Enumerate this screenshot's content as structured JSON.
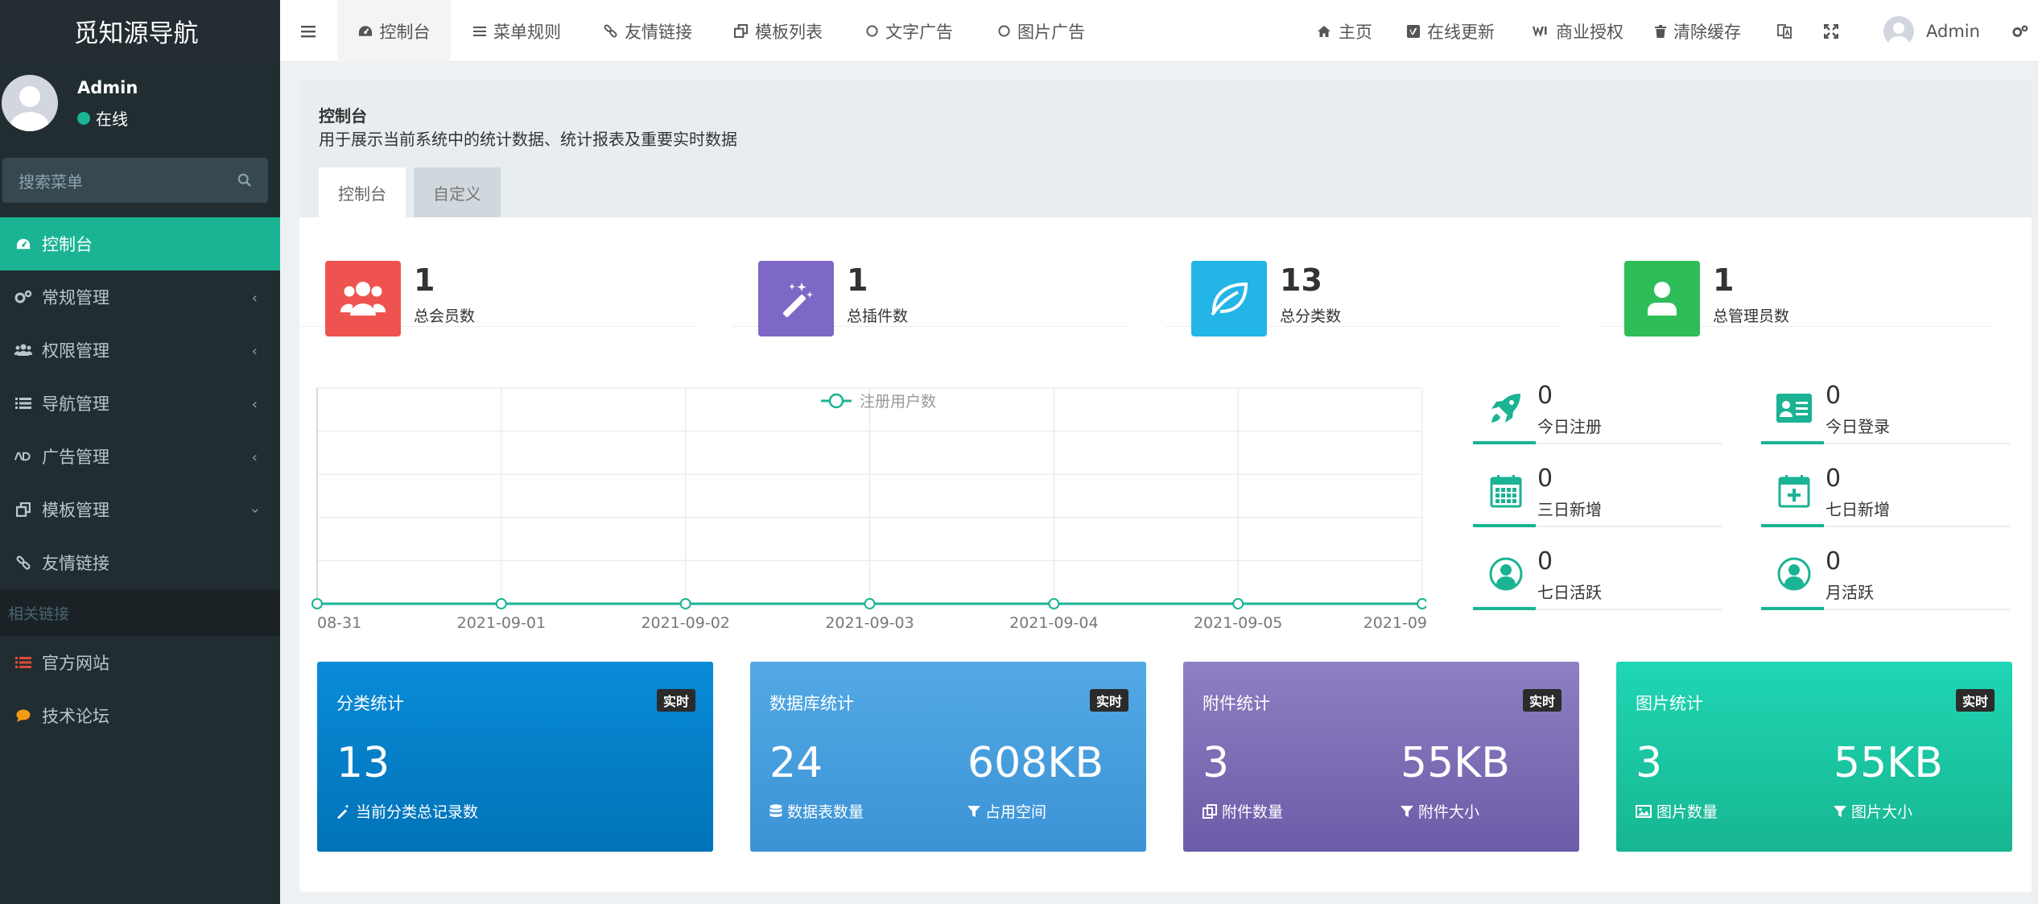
{
  "sidebar": {
    "logo": "觅知源导航",
    "user": {
      "name": "Admin",
      "status": "在线"
    },
    "search_placeholder": "搜索菜单",
    "menu": [
      {
        "label": "控制台",
        "icon": "dashboard-icon",
        "active": true
      },
      {
        "label": "常规管理",
        "icon": "cogs-icon"
      },
      {
        "label": "权限管理",
        "icon": "users-icon"
      },
      {
        "label": "导航管理",
        "icon": "list-icon"
      },
      {
        "label": "广告管理",
        "icon": "ad-icon"
      },
      {
        "label": "模板管理",
        "icon": "clone-icon"
      },
      {
        "label": "友情链接",
        "icon": "link-icon"
      }
    ],
    "related_heading": "相关链接",
    "related": [
      {
        "label": "官方网站",
        "icon": "list-red-icon",
        "color": "#dd4b39"
      },
      {
        "label": "技术论坛",
        "icon": "comment-yellow-icon",
        "color": "#f39c12"
      }
    ]
  },
  "topbar": {
    "left_tabs": [
      "控制台",
      "菜单规则",
      "友情链接",
      "模板列表",
      "文字广告",
      "图片广告"
    ],
    "right_items": [
      "主页",
      "在线更新",
      "商业授权",
      "清除缓存"
    ],
    "user_name": "Admin"
  },
  "page": {
    "title": "控制台",
    "description": "用于展示当前系统中的统计数据、统计报表及重要实时数据",
    "tabs": [
      "控制台",
      "自定义"
    ]
  },
  "stats": [
    {
      "value": "1",
      "label": "总会员数",
      "color": "#ef5350",
      "icon": "users-icon"
    },
    {
      "value": "1",
      "label": "总插件数",
      "color": "#7e68c5",
      "icon": "magic-wand-icon"
    },
    {
      "value": "13",
      "label": "总分类数",
      "color": "#22b5e6",
      "icon": "leaf-icon"
    },
    {
      "value": "1",
      "label": "总管理员数",
      "color": "#2ebd59",
      "icon": "user-icon"
    }
  ],
  "chart_data": {
    "type": "line",
    "categories": [
      "08-31",
      "2021-09-01",
      "2021-09-02",
      "2021-09-03",
      "2021-09-04",
      "2021-09-05",
      "2021-09"
    ],
    "series": [
      {
        "name": "注册用户数",
        "values": [
          0,
          0,
          0,
          0,
          0,
          0,
          0
        ]
      }
    ],
    "legend": "top-center",
    "grid": true,
    "color": "#1ab394"
  },
  "mini_stats": [
    {
      "value": "0",
      "label": "今日注册",
      "icon": "rocket-icon"
    },
    {
      "value": "0",
      "label": "今日登录",
      "icon": "id-card-icon"
    },
    {
      "value": "0",
      "label": "三日新增",
      "icon": "calendar-icon"
    },
    {
      "value": "0",
      "label": "七日新增",
      "icon": "calendar-plus-icon"
    },
    {
      "value": "0",
      "label": "七日活跃",
      "icon": "user-circle-icon"
    },
    {
      "value": "0",
      "label": "月活跃",
      "icon": "user-circle-icon"
    }
  ],
  "cards": [
    {
      "title": "分类统计",
      "badge": "实时",
      "v1": "13",
      "l1": "当前分类总记录数",
      "v2": "",
      "l2": "",
      "c1": "#0a8bd8",
      "c2": "#0073b7"
    },
    {
      "title": "数据库统计",
      "badge": "实时",
      "v1": "24",
      "l1": "数据表数量",
      "v2": "608KB",
      "l2": "占用空间",
      "c1": "#53a9e5",
      "c2": "#3b93d6"
    },
    {
      "title": "附件统计",
      "badge": "实时",
      "v1": "3",
      "l1": "附件数量",
      "v2": "55KB",
      "l2": "附件大小",
      "c1": "#8e7fc2",
      "c2": "#6c5ca8"
    },
    {
      "title": "图片统计",
      "badge": "实时",
      "v1": "3",
      "l1": "图片数量",
      "v2": "55KB",
      "l2": "图片大小",
      "c1": "#1fd6b4",
      "c2": "#17b691"
    }
  ]
}
